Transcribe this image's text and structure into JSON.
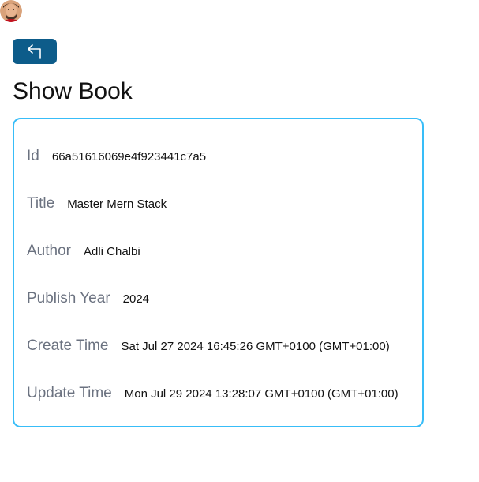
{
  "header": {
    "avatar_icon": "user-avatar-icon",
    "back_icon": "arrow-back-icon",
    "back_button_color": "#0d5c8a"
  },
  "page": {
    "title": "Show Book"
  },
  "card": {
    "border_color": "#38bdf8",
    "fields": [
      {
        "label": "Id",
        "value": "66a51616069e4f923441c7a5"
      },
      {
        "label": "Title",
        "value": "Master Mern Stack"
      },
      {
        "label": "Author",
        "value": "Adli Chalbi"
      },
      {
        "label": "Publish Year",
        "value": "2024"
      },
      {
        "label": "Create Time",
        "value": "Sat Jul 27 2024 16:45:26 GMT+0100 (GMT+01:00)"
      },
      {
        "label": "Update Time",
        "value": "Mon Jul 29 2024 13:28:07 GMT+0100 (GMT+01:00)"
      }
    ]
  }
}
